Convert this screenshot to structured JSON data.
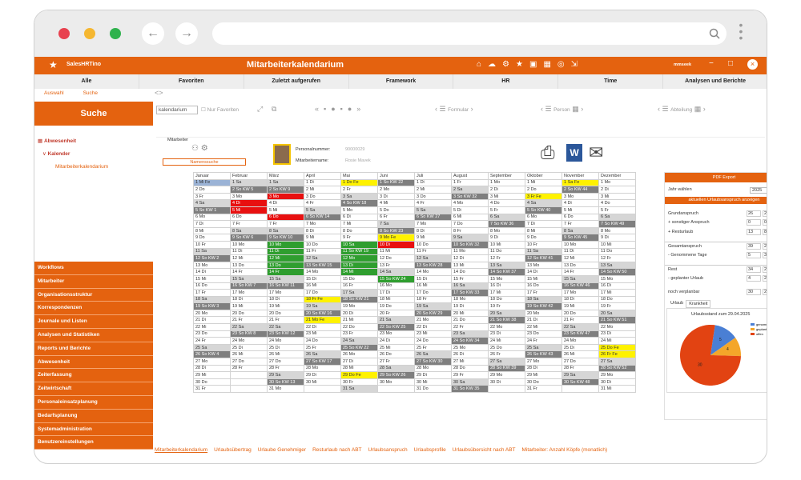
{
  "app": {
    "name": "SalesHRTino",
    "title": "Mitarbeiterkalendarium",
    "user": "mmseek"
  },
  "menu": [
    "Alle",
    "Favoriten",
    "Zuletzt aufgerufen",
    "Framework",
    "HR",
    "Time",
    "Analysen und Berichte"
  ],
  "subtabs": [
    "Auswahl",
    "Suche"
  ],
  "search": {
    "title": "Suche"
  },
  "tree": {
    "parent": "Abwesenheit",
    "group": "Kalender",
    "leaf": "Mitarbeiterkalendarium"
  },
  "modules": [
    "Workflows",
    "Mitarbeiter",
    "Organisationsstruktur",
    "Korrespondenzen",
    "Journale und Listen",
    "Analysen und Statistiken",
    "Reports und Berichte",
    "Abwesenheit",
    "Zeiterfassung",
    "Zeitwirtschaft",
    "Personaleinsatzplanung",
    "Bedarfsplanung",
    "Systemadministration",
    "Benutzereinstellungen"
  ],
  "toolbar": {
    "input": "kalendarium",
    "favorites": "Nur Favoriten",
    "formular": "Formular",
    "person": "Person",
    "abteilung": "Abteilung"
  },
  "employee": {
    "label": "Mitarbeiter",
    "search": "Namenssuche",
    "personnel_label": "Personalnummer:",
    "personnel_value": "90000029",
    "name_label": "Mitarbeitername:",
    "name_value": "Rosie Mavek"
  },
  "months": [
    "Januar",
    "Februar",
    "März",
    "April",
    "Mai",
    "Juni",
    "Juli",
    "August",
    "September",
    "Oktober",
    "November",
    "Dezember"
  ],
  "calendar": [
    [
      "1 Mi Fe",
      "1 Sa",
      "1 Sa",
      "1 Di",
      "1 Do Fe",
      "1 So KW 22",
      "1 Di",
      "1 Fr",
      "1 Mo",
      "1 Mi",
      "1 Sa Fe",
      "1 Mo"
    ],
    [
      "2 Do",
      "2 So KW 5",
      "2 So KW 9",
      "2 Mi",
      "2 Fr",
      "2 Mo",
      "2 Mi",
      "2 Sa",
      "2 Di",
      "2 Do",
      "2 So KW 44",
      "2 Di"
    ],
    [
      "3 Fr",
      "3 Mo",
      "3 Mo",
      "3 Do",
      "3 Sa",
      "3 Di",
      "3 Do",
      "3 So KW 32",
      "3 Mi",
      "3 Fr Fe",
      "3 Mo",
      "3 Mi"
    ],
    [
      "4 Sa",
      "4 Di",
      "4 Di",
      "4 Fr",
      "4 So KW 18",
      "4 Mi",
      "4 Fr",
      "4 Mo",
      "4 Do",
      "4 Sa",
      "4 Di",
      "4 Do"
    ],
    [
      "5 So KW 1",
      "5 Mi",
      "5 Mi",
      "5 Sa",
      "5 Mo",
      "5 Do",
      "5 Sa",
      "5 Di",
      "5 Fr",
      "5 So KW 40",
      "5 Mi",
      "5 Fr"
    ],
    [
      "6 Mo",
      "6 Do",
      "6 Do",
      "6 So KW 14",
      "6 Di",
      "6 Fr",
      "6 So KW 27",
      "6 Mi",
      "6 Sa",
      "6 Mo",
      "6 Do",
      "6 Sa"
    ],
    [
      "7 Di",
      "7 Fr",
      "7 Fr",
      "7 Mo",
      "7 Mi",
      "7 Sa",
      "7 Mo",
      "7 Do",
      "7 So KW 36",
      "7 Di",
      "7 Fr",
      "7 So KW 49"
    ],
    [
      "8 Mi",
      "8 Sa",
      "8 Sa",
      "8 Di",
      "8 Do",
      "8 So KW 23",
      "8 Di",
      "8 Fr",
      "8 Mo",
      "8 Mi",
      "8 Sa",
      "8 Mo"
    ],
    [
      "9 Do",
      "9 So KW 6",
      "9 So KW 10",
      "9 Mi",
      "9 Fr",
      "9 Mo Fe",
      "9 Mi",
      "9 Sa",
      "9 Di",
      "9 Do",
      "9 So KW 45",
      "9 Di"
    ],
    [
      "10 Fr",
      "10 Mo",
      "10 Mo",
      "10 Do",
      "10 Sa",
      "10 Di",
      "10 Do",
      "10 So KW 32",
      "10 Mi",
      "10 Fr",
      "10 Mo",
      "10 Mi"
    ],
    [
      "11 Sa",
      "11 Di",
      "11 Di",
      "11 Fr",
      "11 So KW 19",
      "11 Mi",
      "11 Fr",
      "11 Mo",
      "11 Do",
      "11 Sa",
      "11 Di",
      "11 Do"
    ],
    [
      "12 So KW 2",
      "12 Mi",
      "12 Mi",
      "12 Sa",
      "12 Mo",
      "12 Do",
      "12 Sa",
      "12 Di",
      "12 Fr",
      "12 So KW 41",
      "12 Mi",
      "12 Fr"
    ],
    [
      "13 Mo",
      "13 Do",
      "13 Do",
      "13 So KW 15",
      "13 Di",
      "13 Fr",
      "13 So KW 28",
      "13 Mi",
      "13 Sa",
      "13 Mo",
      "13 Do",
      "13 Sa"
    ],
    [
      "14 Di",
      "14 Fr",
      "14 Fr",
      "14 Mo",
      "14 Mi",
      "14 Sa",
      "14 Mo",
      "14 Do",
      "14 So KW 37",
      "14 Di",
      "14 Fr",
      "14 So KW 50"
    ],
    [
      "15 Mi",
      "15 Sa",
      "15 Sa",
      "15 Di",
      "15 Do",
      "15 So KW 24",
      "15 Di",
      "15 Fr",
      "15 Mo",
      "15 Mi",
      "15 Sa",
      "15 Mo"
    ],
    [
      "16 Do",
      "16 So KW 7",
      "16 So KW 11",
      "16 Mi",
      "16 Fr",
      "16 Mo",
      "16 Mi",
      "16 Sa",
      "16 Di",
      "16 Do",
      "16 So KW 46",
      "16 Di"
    ],
    [
      "17 Fr",
      "17 Mo",
      "17 Mo",
      "17 Do",
      "17 Sa",
      "17 Di",
      "17 Do",
      "17 So KW 33",
      "17 Mi",
      "17 Fr",
      "17 Mo",
      "17 Mi"
    ],
    [
      "18 Sa",
      "18 Di",
      "18 Di",
      "18 Fr Fe",
      "18 So KW 21",
      "18 Mi",
      "18 Fr",
      "18 Mo",
      "18 Do",
      "18 Sa",
      "18 Di",
      "18 Do"
    ],
    [
      "19 So KW 3",
      "19 Mi",
      "19 Mi",
      "19 Sa",
      "19 Mo",
      "19 Do",
      "19 Sa",
      "19 Di",
      "19 Fr",
      "19 So KW 42",
      "19 Mi",
      "19 Fr"
    ],
    [
      "20 Mo",
      "20 Do",
      "20 Do",
      "20 So KW 16",
      "20 Di",
      "20 Fr",
      "20 So KW 29",
      "20 Mi",
      "20 Sa",
      "20 Mo",
      "20 Do",
      "20 Sa"
    ],
    [
      "21 Di",
      "21 Fr",
      "21 Fr",
      "21 Mo Fe",
      "21 Mi",
      "21 Sa",
      "21 Mo",
      "21 Do",
      "21 So KW 38",
      "21 Di",
      "21 Fr",
      "21 So KW 51"
    ],
    [
      "22 Mi",
      "22 Sa",
      "22 Sa",
      "22 Di",
      "22 Do",
      "22 So KW 25",
      "22 Di",
      "22 Fr",
      "22 Mo",
      "22 Mi",
      "22 Sa",
      "22 Mo"
    ],
    [
      "23 Do",
      "23 So KW 8",
      "23 So KW 12",
      "23 Mi",
      "23 Fr",
      "23 Mo",
      "23 Mi",
      "23 Sa",
      "23 Di",
      "23 Do",
      "23 So KW 47",
      "23 Di"
    ],
    [
      "24 Fr",
      "24 Mo",
      "24 Mo",
      "24 Do",
      "24 Sa",
      "24 Di",
      "24 Do",
      "24 So KW 34",
      "24 Mi",
      "24 Fr",
      "24 Mo",
      "24 Mi"
    ],
    [
      "25 Sa",
      "25 Di",
      "25 Di",
      "25 Fr",
      "25 So KW 22",
      "25 Mi",
      "25 Fr",
      "25 Mo",
      "25 Do",
      "25 Sa",
      "25 Di",
      "25 Do Fe"
    ],
    [
      "26 So KW 4",
      "26 Mi",
      "26 Mi",
      "26 Sa",
      "26 Mo",
      "26 Do",
      "26 Sa",
      "26 Di",
      "26 Fr",
      "26 So KW 43",
      "26 Mi",
      "26 Fr Fe"
    ],
    [
      "27 Mo",
      "27 Do",
      "27 Do",
      "27 So KW 17",
      "27 Di",
      "27 Fr",
      "27 So KW 30",
      "27 Mi",
      "27 Sa",
      "27 Mo",
      "27 Do",
      "27 Sa"
    ],
    [
      "28 Di",
      "28 Fr",
      "28 Fr",
      "28 Mo",
      "28 Mi",
      "28 Sa",
      "28 Mo",
      "28 Do",
      "28 So KW 39",
      "28 Di",
      "28 Fr",
      "28 So KW 52"
    ],
    [
      "29 Mi",
      "",
      "29 Sa",
      "29 Di",
      "29 Do Fe",
      "29 So KW 26",
      "29 Di",
      "29 Fr",
      "29 Mo",
      "29 Mi",
      "29 Sa",
      "29 Mo"
    ],
    [
      "30 Do",
      "",
      "30 So KW 13",
      "30 Mi",
      "30 Fr",
      "30 Mo",
      "30 Mi",
      "30 Sa",
      "30 Di",
      "30 Do",
      "30 So KW 48",
      "30 Di"
    ],
    [
      "31 Fr",
      "",
      "31 Mo",
      "",
      "31 Sa",
      "",
      "31 Do",
      "31 So KW 35",
      "",
      "31 Fr",
      "",
      "31 Mi"
    ]
  ],
  "panel": {
    "pdf": "PDF Export",
    "year_label": "Jahr wählen",
    "year": "2025",
    "show_btn": "aktuellen Urlaubsanspruch anzeigen",
    "rows": [
      [
        "Grundanspruch",
        "26",
        "200"
      ],
      [
        "+ sonstiger Anspruch",
        "0",
        "0"
      ],
      [
        "+ Resturlaub",
        "13",
        "85,57"
      ],
      [
        "Gesamtanspruch",
        "39",
        "286,5"
      ],
      [
        "- Genommene Tage",
        "5",
        "33,33"
      ],
      [
        "Rest",
        "34",
        "253,3"
      ],
      [
        "- geplanter Urlaub",
        "4",
        "26,67"
      ],
      [
        "noch verplanbar",
        "30",
        "226,5"
      ]
    ],
    "tabs": [
      "Urlaub",
      "Krankheit"
    ],
    "chart_title": "Urlaubsstand zum 29.04.2025"
  },
  "chart_data": {
    "type": "pie",
    "title": "Urlaubsstand zum 29.04.2025",
    "labels": [
      "genommen",
      "geplant",
      "offen"
    ],
    "values": [
      5,
      4,
      30
    ],
    "colors": [
      "#4a7fd4",
      "#f4a62a",
      "#e24312"
    ]
  },
  "bottom": [
    "Mitarbeiterkalendarium",
    "Urlaubsübertrag",
    "Urlaube Genehmiger",
    "Resturlaub nach ABT",
    "Urlaubsanspruch",
    "Urlaubsprofile",
    "Urlaubsübersicht nach ABT",
    "Mitarbeiter: Anzahl Köpfe (monatlich)"
  ]
}
